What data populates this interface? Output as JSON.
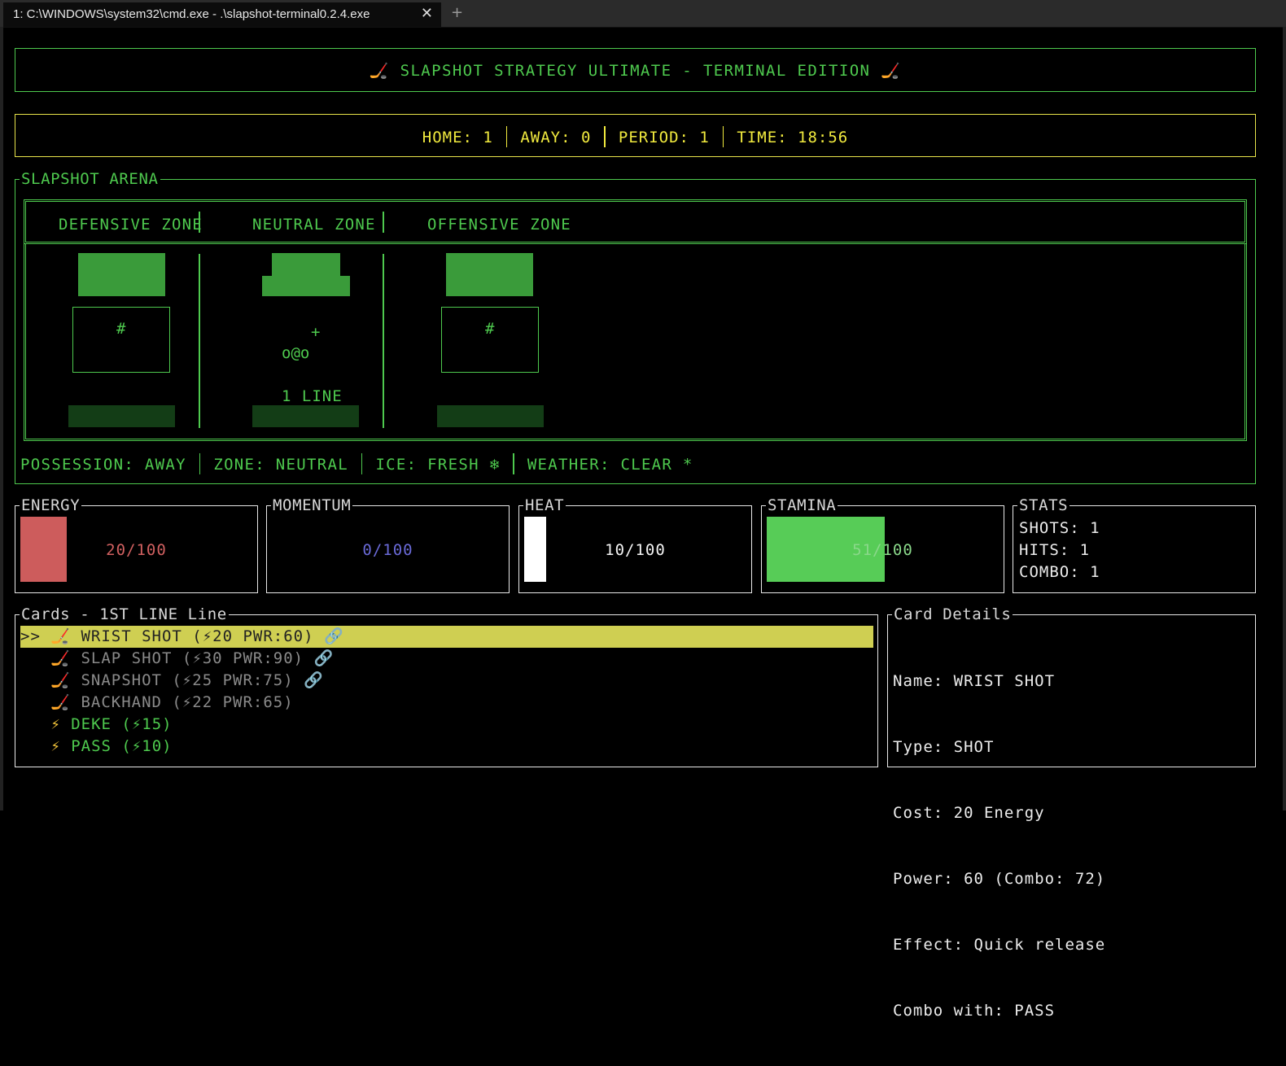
{
  "window": {
    "tab_title": "1: C:\\WINDOWS\\system32\\cmd.exe - .\\slapshot-terminal0.2.4.exe",
    "close_glyph": "✕",
    "new_tab_glyph": "+"
  },
  "title": {
    "icon_left": "🏒",
    "text": " SLAPSHOT STRATEGY ULTIMATE - TERMINAL EDITION ",
    "icon_right": "🏒"
  },
  "scoreboard": {
    "home": "HOME: 1",
    "away": "AWAY: 0",
    "period": "PERIOD: 1",
    "time": "TIME: 18:56"
  },
  "arena": {
    "title": "SLAPSHOT ARENA",
    "zones": [
      "DEFENSIVE ZONE",
      "NEUTRAL ZONE",
      "OFFENSIVE ZONE"
    ],
    "defensive_net_glyph": "#",
    "offensive_net_glyph": "#",
    "puck_glyph": "+",
    "player_glyph": "o@o",
    "line_label": "1 LINE"
  },
  "status": {
    "possession": "POSSESSION: AWAY",
    "zone": "ZONE: NEUTRAL",
    "ice": "ICE: FRESH ❄",
    "weather": "WEATHER: CLEAR *"
  },
  "meters": {
    "energy": {
      "label": "ENERGY",
      "value": "20/100",
      "level": 0.2,
      "color": "#cd5c5c"
    },
    "momentum": {
      "label": "MOMENTUM",
      "value": "0/100",
      "level": 0.0,
      "color": "#5b5bd0"
    },
    "heat": {
      "label": "HEAT",
      "value": "10/100",
      "level": 0.1,
      "color": "#ffffff"
    },
    "stamina": {
      "label": "STAMINA",
      "value": "51/100",
      "level": 0.51,
      "color": "#57cc57"
    }
  },
  "stats": {
    "label": "STATS",
    "shots": "SHOTS: 1",
    "hits": "HITS: 1",
    "combo": "COMBO: 1"
  },
  "cards": {
    "title": "Cards - 1ST LINE Line",
    "items": [
      {
        "prefix": ">> ",
        "icon": "🏒",
        "text": " WRIST SHOT (⚡20 PWR:60) ",
        "link": "🔗",
        "state": "selected"
      },
      {
        "prefix": "   ",
        "icon": "🏒",
        "text": " SLAP SHOT (⚡30 PWR:90) ",
        "link": "🔗",
        "state": "dim"
      },
      {
        "prefix": "   ",
        "icon": "🏒",
        "text": " SNAPSHOT (⚡25 PWR:75) ",
        "link": "🔗",
        "state": "dim"
      },
      {
        "prefix": "   ",
        "icon": "🏒",
        "text": " BACKHAND (⚡22 PWR:65)",
        "link": "",
        "state": "dim"
      },
      {
        "prefix": "   ",
        "icon": "⚡",
        "text": " DEKE (⚡15)",
        "link": "",
        "state": "play"
      },
      {
        "prefix": "   ",
        "icon": "⚡",
        "text": " PASS (⚡10)",
        "link": "",
        "state": "play"
      }
    ]
  },
  "details": {
    "title": "Card Details",
    "name": "Name: WRIST SHOT",
    "type": "Type: SHOT",
    "cost": "Cost: 20 Energy",
    "power": "Power: 60 (Combo: 72)",
    "effect": "Effect: Quick release",
    "combo": "Combo with: PASS"
  }
}
